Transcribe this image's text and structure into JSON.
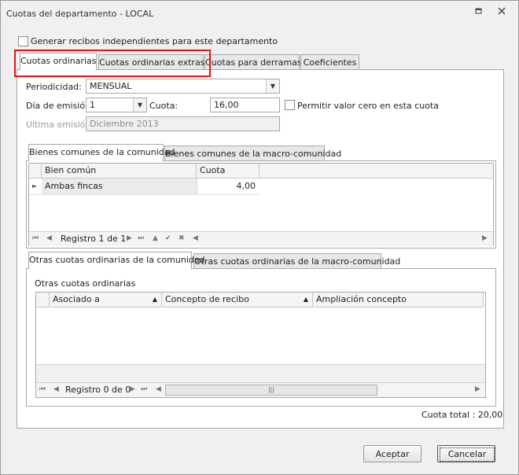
{
  "window": {
    "title": "Cuotas del departamento - LOCAL",
    "restore_icon": "restore-icon",
    "close_icon": "close-icon"
  },
  "independent_receipts_label": "Generar recibos independientes para este departamento",
  "main_tabs": [
    {
      "label": "Cuotas ordinarias"
    },
    {
      "label": "Cuotas ordinarias extras"
    },
    {
      "label": "Cuotas para derramas"
    },
    {
      "label": "Coeficientes"
    }
  ],
  "form": {
    "periodicidad_label": "Periodicidad:",
    "periodicidad_value": "MENSUAL",
    "dia_label": "Día de emisión:",
    "dia_value": "1",
    "cuota_label": "Cuota:",
    "cuota_value": "16,00",
    "permitir_label": "Permitir valor cero en esta cuota",
    "ultima_label": "Última emisión:",
    "ultima_value": "Diciembre 2013"
  },
  "bienes_tabs": [
    {
      "label": "Bienes comunes de la comunidad"
    },
    {
      "label": "Bienes comunes de la macro-comunidad"
    }
  ],
  "bienes_grid": {
    "columns": [
      "Bien común",
      "Cuota"
    ],
    "rows": [
      {
        "bien": "Ambas fincas",
        "cuota": "4,00"
      }
    ],
    "record_text": "Registro 1 de 1"
  },
  "otras_tabs": [
    {
      "label": "Otras cuotas ordinarias de la comunidad"
    },
    {
      "label": "Otras cuotas ordinarias de la macro-comunidad"
    }
  ],
  "otras": {
    "section_label": "Otras cuotas ordinarias",
    "columns": [
      "Asociado a",
      "Concepto de recibo",
      "Ampliación concepto"
    ],
    "record_text": "Registro 0 de 0"
  },
  "total_label": "Cuota total : 20,00",
  "buttons": {
    "accept": "Aceptar",
    "cancel": "Cancelar"
  },
  "highlight_color": "#e01515"
}
